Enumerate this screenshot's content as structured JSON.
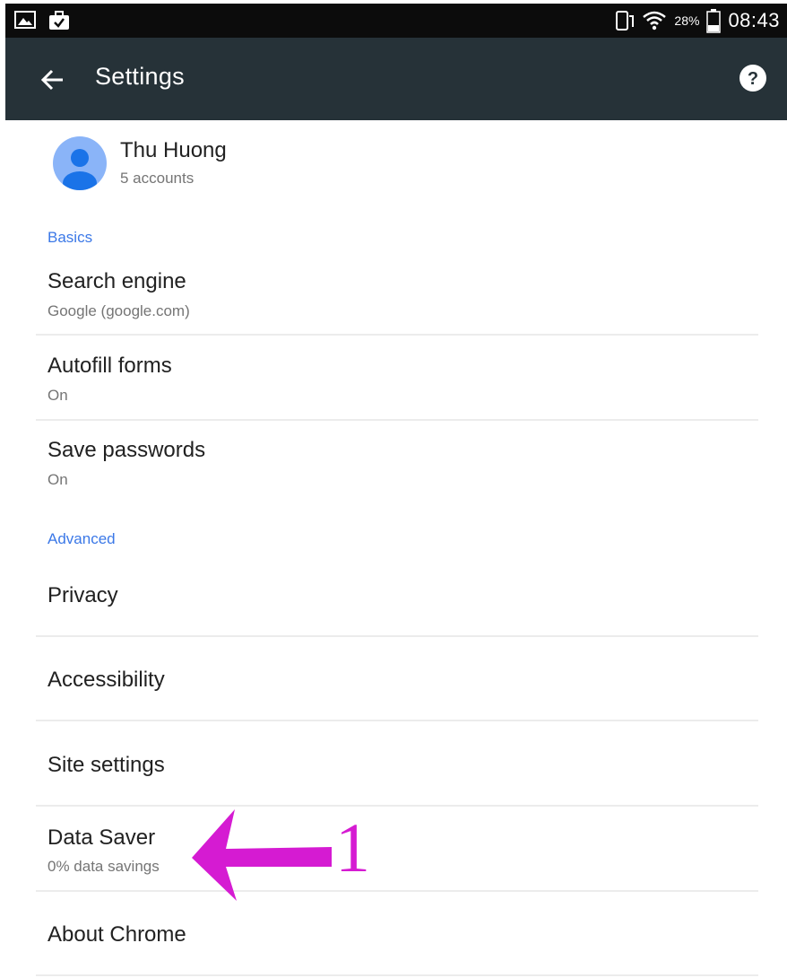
{
  "status_bar": {
    "battery": "28%",
    "time": "08:43",
    "icons": [
      "gallery-icon",
      "briefcase-check-icon",
      "phone-rotate-icon",
      "wifi-icon",
      "battery-icon"
    ]
  },
  "app_bar": {
    "title": "Settings",
    "back_icon": "arrow-back-icon",
    "help_icon": "help-icon"
  },
  "account": {
    "name": "Thu Huong",
    "subtitle": "5 accounts"
  },
  "sections": {
    "basics": "Basics",
    "advanced": "Advanced"
  },
  "items": {
    "search_engine": {
      "title": "Search engine",
      "subtitle": "Google (google.com)"
    },
    "autofill": {
      "title": "Autofill forms",
      "subtitle": "On"
    },
    "passwords": {
      "title": "Save passwords",
      "subtitle": "On"
    },
    "privacy": {
      "title": "Privacy"
    },
    "accessibility": {
      "title": "Accessibility"
    },
    "site_settings": {
      "title": "Site settings"
    },
    "data_saver": {
      "title": "Data Saver",
      "subtitle": "0% data savings"
    },
    "about": {
      "title": "About Chrome"
    }
  },
  "annotation": {
    "label": "1",
    "color": "#d51bd2"
  },
  "colors": {
    "app_bar": "#263238",
    "status_bar": "#0c0c0c",
    "section_header": "#3b78e7",
    "avatar": "#8ab4f8"
  }
}
